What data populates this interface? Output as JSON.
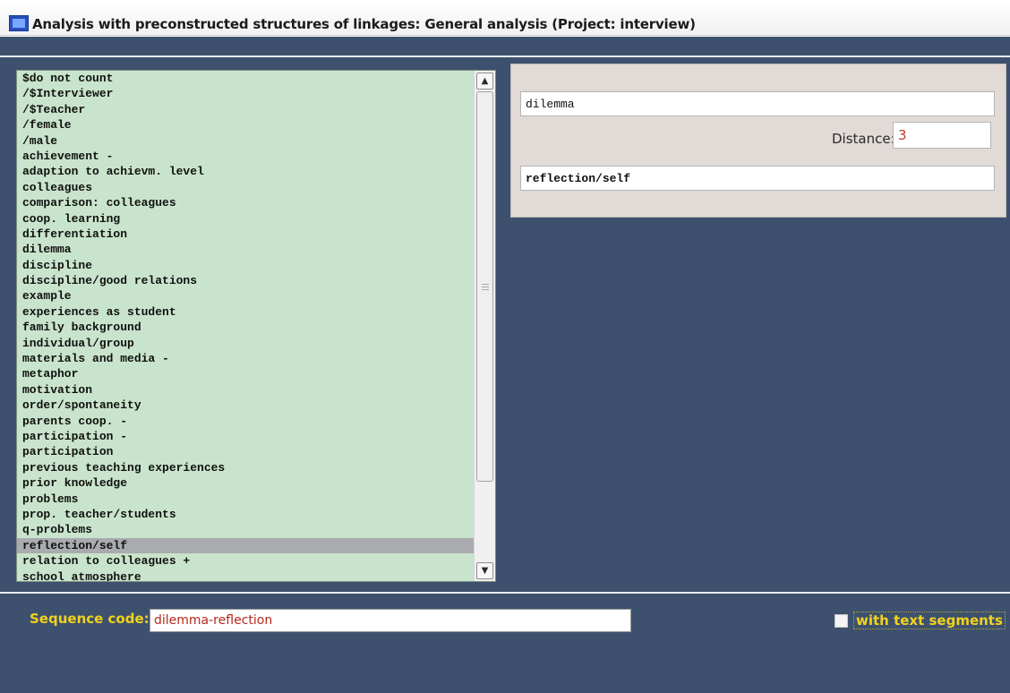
{
  "window": {
    "title": "Analysis with preconstructed structures of linkages: General analysis (Project: interview)"
  },
  "code_list": {
    "items": [
      "$do not count",
      "/$Interviewer",
      "/$Teacher",
      "/female",
      "/male",
      "achievement -",
      "adaption to achievm. level",
      "colleagues",
      "comparison: colleagues",
      "coop. learning",
      "differentiation",
      "dilemma",
      "discipline",
      "discipline/good relations",
      "example",
      "experiences as student",
      "family background",
      "individual/group",
      "materials and media -",
      "metaphor",
      "motivation",
      "order/spontaneity",
      "parents coop. -",
      "participation -",
      "participation",
      "previous teaching experiences",
      "prior knowledge",
      "problems",
      "prop. teacher/students",
      "q-problems",
      "reflection/self",
      "relation to colleagues +",
      "school atmosphere"
    ],
    "selected": "reflection/self"
  },
  "linkage": {
    "first_code": "dilemma",
    "distance_label": "Distance:",
    "distance_value": "3",
    "second_code": "reflection/self"
  },
  "sequence": {
    "label": "Sequence code:",
    "value": "dilemma-reflection"
  },
  "options": {
    "with_text_segments_label": "with text segments",
    "with_text_segments_checked": false
  },
  "colors": {
    "window_background": "#3d516e",
    "list_background": "#c9e4cc",
    "selected_row": "#a9abae",
    "panel_background": "#e1dad6",
    "label_yellow": "#f2d21c",
    "value_red": "#b3281c"
  },
  "icons": {
    "app": "app-icon",
    "scroll_up": "chevron-up-icon",
    "scroll_down": "chevron-down-icon"
  }
}
